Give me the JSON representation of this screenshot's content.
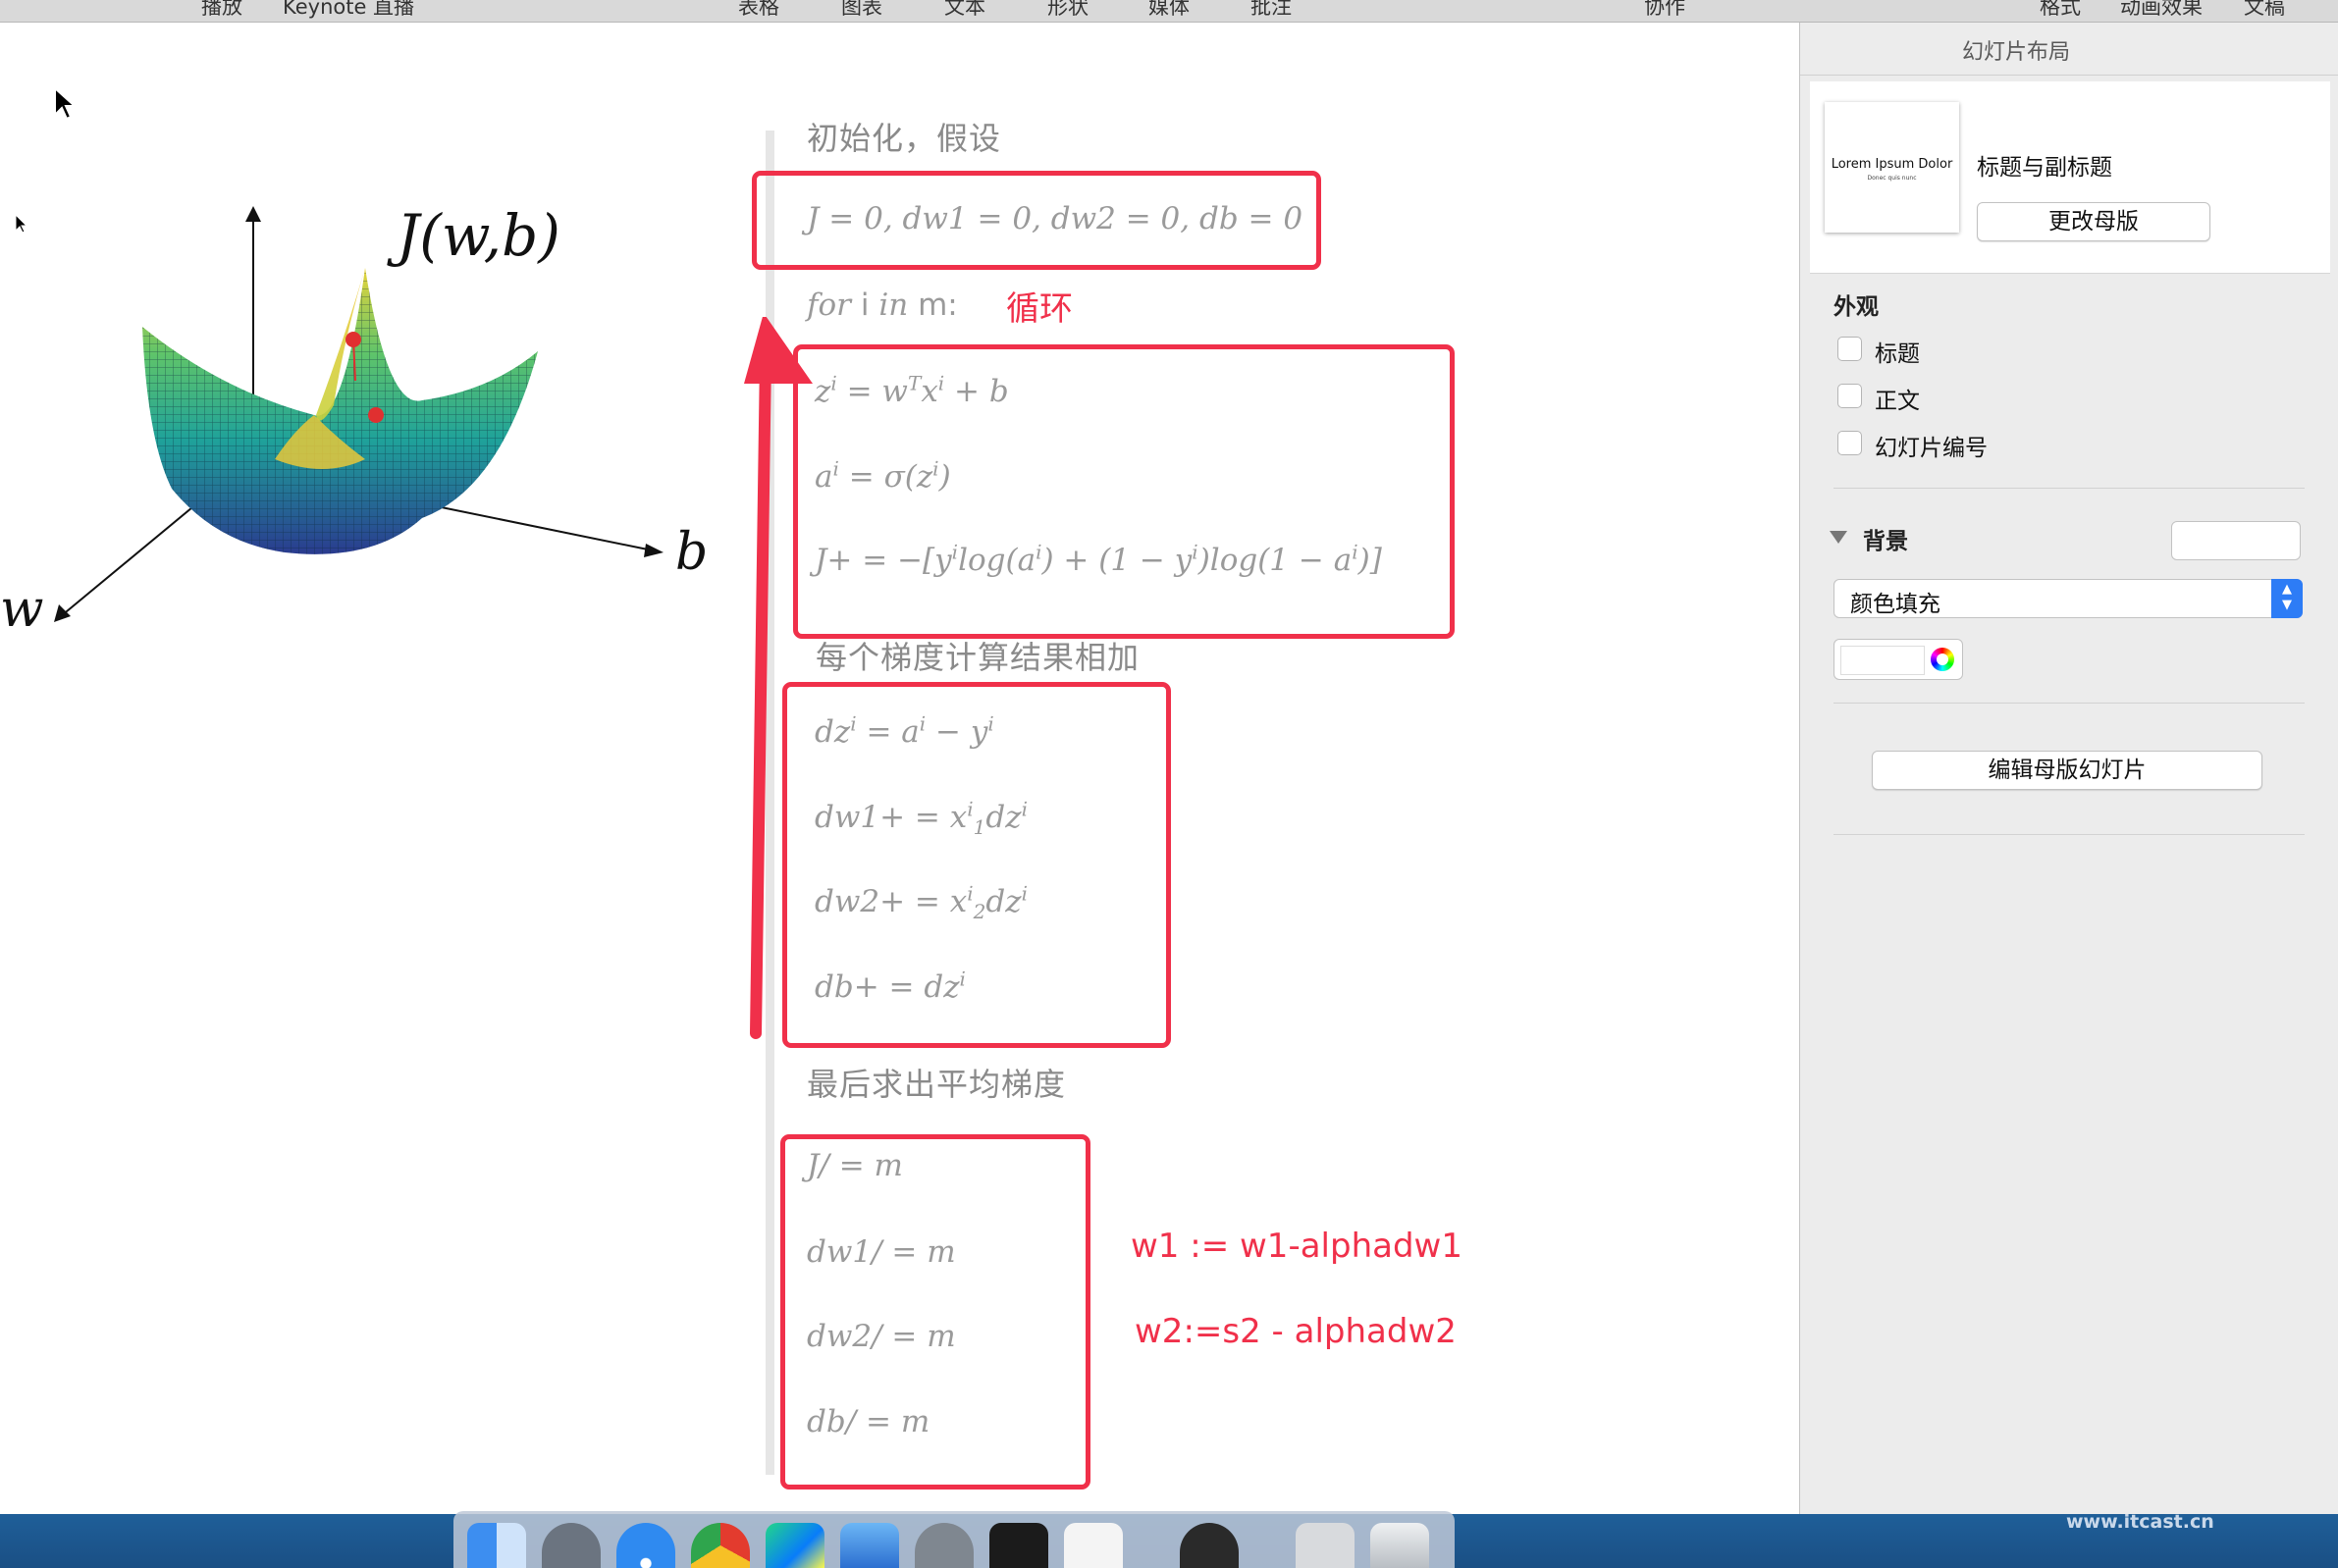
{
  "toolbar": {
    "left_items": [
      "播放",
      "Keynote 直播"
    ],
    "center_items": [
      "表格",
      "图表",
      "文本",
      "形状",
      "媒体",
      "批注"
    ],
    "collab": "协作",
    "right_items": [
      "格式",
      "动画效果",
      "文稿"
    ]
  },
  "slide": {
    "surface_label": "J(w,b)",
    "axis_w": "w",
    "axis_b": "b",
    "heading_init": "初始化，假设",
    "init_formula": "J = 0, dw1 = 0, dw2 = 0, db = 0",
    "loop_keyword": "for",
    "loop_var": "i",
    "loop_in": "in",
    "loop_end": "m:",
    "loop_note": "循环",
    "forward_z": {
      "lhs": "z",
      "lhs_sup": "i",
      "eq": " = w",
      "w_sup": "T",
      "x": "x",
      "x_sup": "i",
      "rest": " + b"
    },
    "forward_a": {
      "lhs": "a",
      "lhs_sup": "i",
      "mid": " = σ(z",
      "mid_sup": "i",
      "end": ")"
    },
    "cost_accum": "J+ = −[y",
    "cost_sup1": "i",
    "cost_part2": "log(a",
    "cost_sup2": "i",
    "cost_part3": ") + (1 − y",
    "cost_sup3": "i",
    "cost_part4": ")log(1 − a",
    "cost_sup4": "i",
    "cost_end": ")]",
    "heading_sum": "每个梯度计算结果相加",
    "grad_dz": {
      "a": "dz",
      "s1": "i",
      "b": " = a",
      "s2": "i",
      "c": " − y",
      "s3": "i"
    },
    "grad_dw1": {
      "a": "dw1+ = x",
      "sup": "i",
      "sub": "1",
      "b": "dz",
      "s2": "i"
    },
    "grad_dw2": {
      "a": "dw2+ = x",
      "sup": "i",
      "sub": "2",
      "b": "dz",
      "s2": "i"
    },
    "grad_db": {
      "a": "db+ = dz",
      "s": "i"
    },
    "heading_avg": "最后求出平均梯度",
    "avg_J": "J/ = m",
    "avg_dw1": "dw1/ = m",
    "avg_dw2": "dw2/ = m",
    "avg_db": "db/ = m",
    "update_w1": "w1 := w1-alphadw1",
    "update_w2": "w2:=s2 - alphadw2"
  },
  "inspector": {
    "title": "幻灯片布局",
    "thumb_title": "Lorem Ipsum Dolor",
    "thumb_subtitle": "Donec quis nunc",
    "layout_name": "标题与副标题",
    "change_master_button": "更改母版",
    "appearance_heading": "外观",
    "checkboxes": [
      {
        "label": "标题",
        "checked": false
      },
      {
        "label": "正文",
        "checked": false
      },
      {
        "label": "幻灯片编号",
        "checked": false
      }
    ],
    "background_heading": "背景",
    "fill_type": "颜色填充",
    "edit_master_button": "编辑母版幻灯片"
  },
  "dock": {
    "icons": [
      "finder-icon",
      "launchpad-icon",
      "safari-icon",
      "chrome-icon",
      "pycharm-icon",
      "keynote-icon",
      "system-preferences-icon",
      "terminal-icon",
      "typora-icon",
      "obs-icon",
      "screen-recorder-icon",
      "trash-icon"
    ],
    "watermark": "www.itcast.cn"
  },
  "colors": {
    "annotation_red": "#f0304a",
    "accent_blue": "#2d7cf6",
    "math_gray": "#9a9a9a"
  }
}
